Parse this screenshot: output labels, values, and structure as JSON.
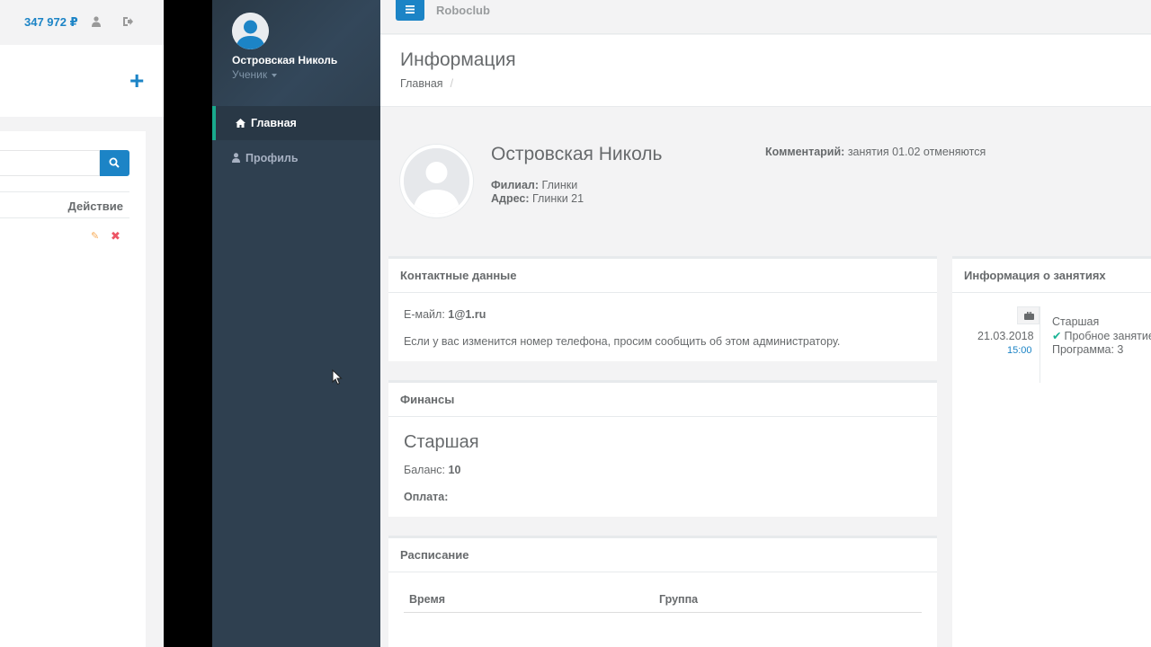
{
  "bg_app": {
    "balance": "347 972 ₽",
    "table_header_action": "Действие"
  },
  "sidebar": {
    "user_name": "Островская Николь",
    "user_role": "Ученик",
    "items": [
      {
        "label": "Главная",
        "icon": "home-icon",
        "active": true
      },
      {
        "label": "Профиль",
        "icon": "user-icon",
        "active": false
      }
    ]
  },
  "topbar": {
    "brand": "Roboclub"
  },
  "page": {
    "title": "Информация",
    "breadcrumb": "Главная",
    "breadcrumb_sep": "/"
  },
  "student": {
    "name": "Островская Николь",
    "branch_label": "Филиал:",
    "branch": "Глинки",
    "address_label": "Адрес:",
    "address": "Глинки 21",
    "comment_label": "Комментарий:",
    "comment": "занятия 01.02 отменяются"
  },
  "contacts": {
    "title": "Контактные данные",
    "email_label": "Е-майл:",
    "email": "1@1.ru",
    "note": "Если у вас изменится номер телефона, просим сообщить об этом администратору."
  },
  "finance": {
    "title": "Финансы",
    "group": "Старшая",
    "balance_label": "Баланс:",
    "balance": "10",
    "payment_label": "Оплата:"
  },
  "schedule": {
    "title": "Расписание",
    "col_time": "Время",
    "col_group": "Группа"
  },
  "lessons": {
    "title": "Информация о занятиях",
    "date": "21.03.2018",
    "time": "15:00",
    "group": "Старшая",
    "type": "Пробное занятие",
    "program": "Программа: 3"
  },
  "colors": {
    "accent": "#1c84c6",
    "sidebar_bg": "#2f4050",
    "active_border": "#19aa8d",
    "success": "#1ab394"
  }
}
